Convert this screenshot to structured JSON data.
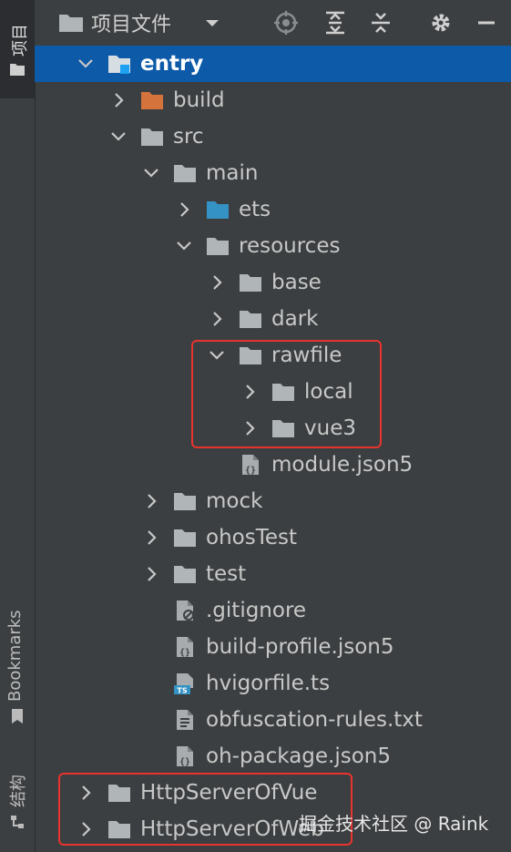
{
  "header": {
    "title": "项目文件"
  },
  "strip": {
    "project_label": "项目",
    "bookmarks_label": "Bookmarks",
    "structure_label": "结构"
  },
  "tree": [
    {
      "label": "entry",
      "depth": 0,
      "expanded": true,
      "icon": "module-folder-icon",
      "selected": true
    },
    {
      "label": "build",
      "depth": 1,
      "expanded": false,
      "icon": "excluded-folder-icon"
    },
    {
      "label": "src",
      "depth": 1,
      "expanded": true,
      "icon": "folder-icon"
    },
    {
      "label": "main",
      "depth": 2,
      "expanded": true,
      "icon": "folder-icon"
    },
    {
      "label": "ets",
      "depth": 3,
      "expanded": false,
      "icon": "source-folder-icon"
    },
    {
      "label": "resources",
      "depth": 3,
      "expanded": true,
      "icon": "folder-icon"
    },
    {
      "label": "base",
      "depth": 4,
      "expanded": false,
      "icon": "folder-icon"
    },
    {
      "label": "dark",
      "depth": 4,
      "expanded": false,
      "icon": "folder-icon"
    },
    {
      "label": "rawfile",
      "depth": 4,
      "expanded": true,
      "icon": "folder-icon"
    },
    {
      "label": "local",
      "depth": 5,
      "expanded": false,
      "icon": "folder-icon"
    },
    {
      "label": "vue3",
      "depth": 5,
      "expanded": false,
      "icon": "folder-icon"
    },
    {
      "label": "module.json5",
      "depth": 4,
      "expanded": null,
      "icon": "json-file-icon"
    },
    {
      "label": "mock",
      "depth": 2,
      "expanded": false,
      "icon": "folder-icon"
    },
    {
      "label": "ohosTest",
      "depth": 2,
      "expanded": false,
      "icon": "folder-icon"
    },
    {
      "label": "test",
      "depth": 2,
      "expanded": false,
      "icon": "folder-icon"
    },
    {
      "label": ".gitignore",
      "depth": 2,
      "expanded": null,
      "icon": "ignore-file-icon"
    },
    {
      "label": "build-profile.json5",
      "depth": 2,
      "expanded": null,
      "icon": "json-file-icon"
    },
    {
      "label": "hvigorfile.ts",
      "depth": 2,
      "expanded": null,
      "icon": "ts-file-icon"
    },
    {
      "label": "obfuscation-rules.txt",
      "depth": 2,
      "expanded": null,
      "icon": "text-file-icon"
    },
    {
      "label": "oh-package.json5",
      "depth": 2,
      "expanded": null,
      "icon": "json-file-icon"
    },
    {
      "label": "HttpServerOfVue",
      "depth": 0,
      "expanded": false,
      "icon": "folder-icon"
    },
    {
      "label": "HttpServerOfWeb",
      "depth": 0,
      "expanded": false,
      "icon": "folder-icon"
    }
  ],
  "watermark": "掘金技术社区 @ Raink",
  "colors": {
    "background": "#3c3f41",
    "selection": "#0d5aa8",
    "folder": "#b0b5b8",
    "excluded_folder": "#d4743c",
    "source_folder": "#3592c4",
    "highlight_box": "#e8332e"
  }
}
